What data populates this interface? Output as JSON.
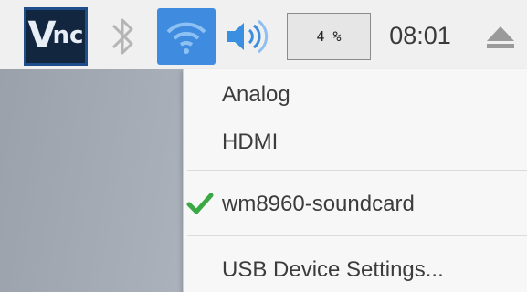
{
  "taskbar": {
    "vnc_logo": {
      "icon": "vnc-logo-icon",
      "text": "V",
      "text2": "nc"
    },
    "bluetooth": {
      "icon": "bluetooth-icon"
    },
    "wifi": {
      "icon": "wifi-icon",
      "bg_color": "#3f8be0"
    },
    "volume": {
      "icon": "speaker-icon",
      "color": "#3b8fe0"
    },
    "cpu_usage": "4 %",
    "clock": "08:01",
    "eject": {
      "icon": "eject-icon"
    }
  },
  "audio_menu": {
    "items": [
      "Analog",
      "HDMI"
    ],
    "selected_device": "wm8960-soundcard",
    "check_icon": "check-icon",
    "check_color": "#3aa845",
    "settings_label": "USB Device Settings..."
  }
}
